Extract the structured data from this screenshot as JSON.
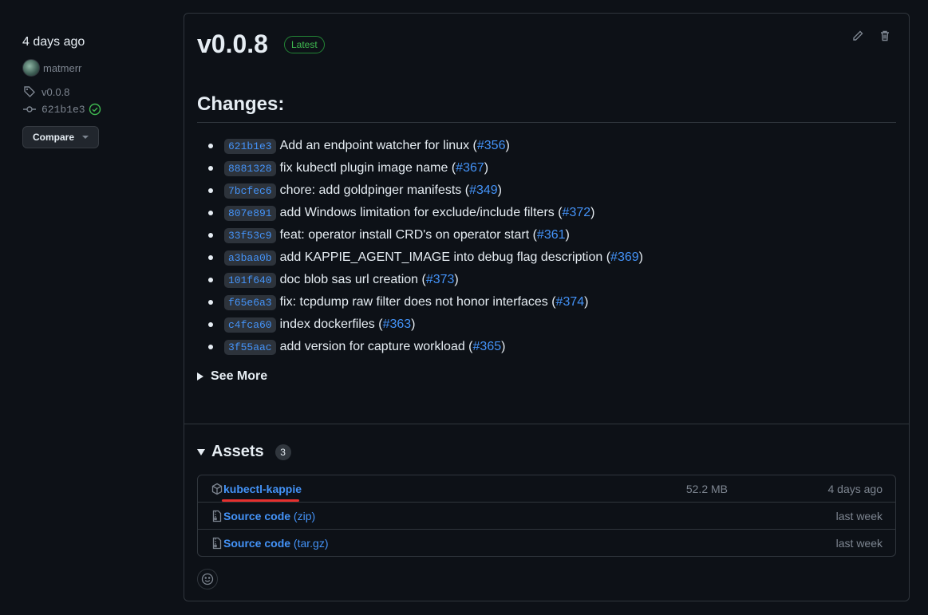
{
  "sidebar": {
    "time": "4 days ago",
    "author": "matmerr",
    "tag": "v0.0.8",
    "commit": "621b1e3",
    "compare_label": "Compare"
  },
  "release": {
    "title": "v0.0.8",
    "badge": "Latest",
    "changes_heading": "Changes:",
    "changes": [
      {
        "sha": "621b1e3",
        "text": "Add an endpoint watcher for linux (",
        "pr": "#356",
        "close": ")"
      },
      {
        "sha": "8881328",
        "text": "fix kubectl plugin image name (",
        "pr": "#367",
        "close": ")"
      },
      {
        "sha": "7bcfec6",
        "text": "chore: add goldpinger manifests (",
        "pr": "#349",
        "close": ")"
      },
      {
        "sha": "807e891",
        "text": "add Windows limitation for exclude/include filters (",
        "pr": "#372",
        "close": ")"
      },
      {
        "sha": "33f53c9",
        "text": "feat: operator install CRD's on operator start (",
        "pr": "#361",
        "close": ")"
      },
      {
        "sha": "a3baa0b",
        "text": "add KAPPIE_AGENT_IMAGE into debug flag description (",
        "pr": "#369",
        "close": ")"
      },
      {
        "sha": "101f640",
        "text": "doc blob sas url creation (",
        "pr": "#373",
        "close": ")"
      },
      {
        "sha": "f65e6a3",
        "text": "fix: tcpdump raw filter does not honor interfaces (",
        "pr": "#374",
        "close": ")"
      },
      {
        "sha": "c4fca60",
        "text": "index dockerfiles (",
        "pr": "#363",
        "close": ")"
      },
      {
        "sha": "3f55aac",
        "text": "add version for capture workload (",
        "pr": "#365",
        "close": ")"
      }
    ],
    "see_more": "See More"
  },
  "assets": {
    "heading": "Assets",
    "count": "3",
    "items": [
      {
        "name": "kubectl-kappie",
        "suffix": "",
        "size": "52.2 MB",
        "date": "4 days ago",
        "icon": "package-icon"
      },
      {
        "name": "Source code",
        "suffix": " (zip)",
        "size": "",
        "date": "last week",
        "icon": "file-zip-icon"
      },
      {
        "name": "Source code",
        "suffix": " (tar.gz)",
        "size": "",
        "date": "last week",
        "icon": "file-zip-icon"
      }
    ]
  },
  "colors": {
    "background": "#0d1117",
    "link": "#4493f8",
    "latest_badge": "#3fb950",
    "annotation_underline": "#e5302e"
  }
}
